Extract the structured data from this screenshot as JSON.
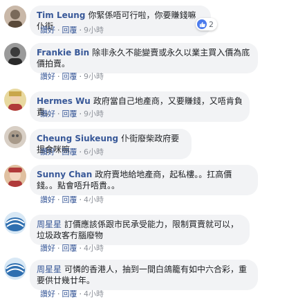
{
  "comments": [
    {
      "author": "Tim Leung",
      "text": "你緊係唔可行啦，你要賺錢嘛仆街",
      "actions": {
        "like": "讚好",
        "reply": "回覆",
        "time": "9小時"
      },
      "reactions": {
        "count": "2",
        "icon": "like-icon",
        "color": "#4b7bec"
      },
      "avatar_colors": [
        "#7a6a5a",
        "#c9b8a8"
      ]
    },
    {
      "author": "Frankie Bin",
      "text": "除非永久不能變賣或永久以業主買入價為底價拍賣。",
      "actions": {
        "like": "讚好",
        "reply": "回覆",
        "time": "9小時"
      },
      "avatar_colors": [
        "#3b3b3b",
        "#9a9a9a"
      ]
    },
    {
      "author": "Hermes Wu",
      "text": "政府當自己地產商，又要賺錢，又唔肯負責。",
      "actions": {
        "like": "讚好",
        "reply": "回覆",
        "time": "9小時"
      },
      "avatar_colors": [
        "#c9a64b",
        "#e8d9a0"
      ]
    },
    {
      "author": "Cheung Siukeung",
      "text": "仆街廢柴政府要搵食咪嘛",
      "actions": {
        "like": "讚好",
        "reply": "回覆",
        "time": "6小時"
      },
      "avatar_colors": [
        "#a89a8a",
        "#d8cfc5"
      ]
    },
    {
      "author": "Sunny Chan",
      "text": "政府賣地給地產商，起私樓。。扛高價錢。。點會唔升唔貴。。",
      "actions": {
        "like": "讚好",
        "reply": "回覆",
        "time": "4小時"
      },
      "avatar_colors": [
        "#b03a3a",
        "#e0c0a0"
      ]
    },
    {
      "author": "周星星",
      "text": "訂價應該係跟市民承受能力，限制買賣就可以，垃圾政客冇腦廢物",
      "actions": {
        "like": "讚好",
        "reply": "回覆",
        "time": "4小時"
      },
      "avatar_colors": [
        "#2f6fb0",
        "#d8e8f5"
      ]
    },
    {
      "author": "周星星",
      "text": "可憐的香港人，抽到一間白鴿籠有如中六合彩，重要供廿幾廿年。",
      "actions": {
        "like": "讚好",
        "reply": "回覆",
        "time": "4小時"
      },
      "avatar_colors": [
        "#2f6fb0",
        "#d8e8f5"
      ]
    }
  ]
}
